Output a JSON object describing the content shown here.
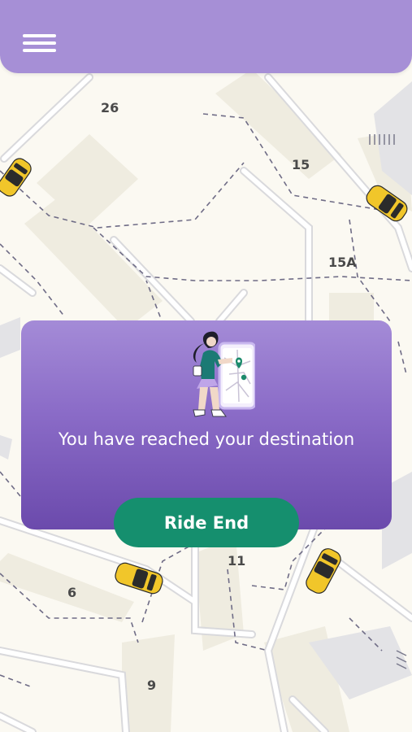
{
  "header": {
    "menu_icon": "hamburger-menu-icon",
    "background": "#a68fd6"
  },
  "map": {
    "block_labels": {
      "b26": "26",
      "b15": "15",
      "b15a": "15A",
      "b11": "11",
      "b6": "6",
      "b9": "9"
    },
    "vehicle_icon": "taxi-icon",
    "vehicle_color": "#f1c62a"
  },
  "dialog": {
    "illustration_icon": "woman-with-map-phone-illustration",
    "message": "You have reached your destination",
    "button_label": "Ride End",
    "button_color": "#158f6e"
  }
}
